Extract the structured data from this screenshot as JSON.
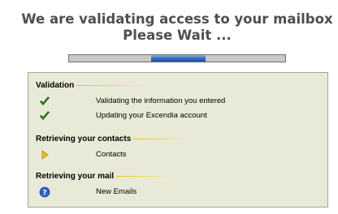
{
  "header": {
    "line1": "We are validating access to your mailbox",
    "line2": "Please Wait ..."
  },
  "progress": {
    "active_segment_start": 0.38,
    "active_segment_end": 0.63
  },
  "colors": {
    "panel_bg": "#e9e9d8",
    "accent_line": "#f1c000",
    "check_green": "#3d8a1e",
    "pending_yellow": "#f1c40f",
    "help_blue": "#2f63c7"
  },
  "sections": [
    {
      "title": "Validation",
      "items": [
        {
          "icon": "checkmark-icon",
          "label": "Validating the information you entered"
        },
        {
          "icon": "checkmark-icon",
          "label": "Updating your Excendia account"
        }
      ]
    },
    {
      "title": "Retrieving your contacts",
      "items": [
        {
          "icon": "play-arrow-icon",
          "label": "Contacts"
        }
      ]
    },
    {
      "title": "Retrieving your mail",
      "items": [
        {
          "icon": "question-icon",
          "label": "New Emails"
        }
      ]
    }
  ]
}
